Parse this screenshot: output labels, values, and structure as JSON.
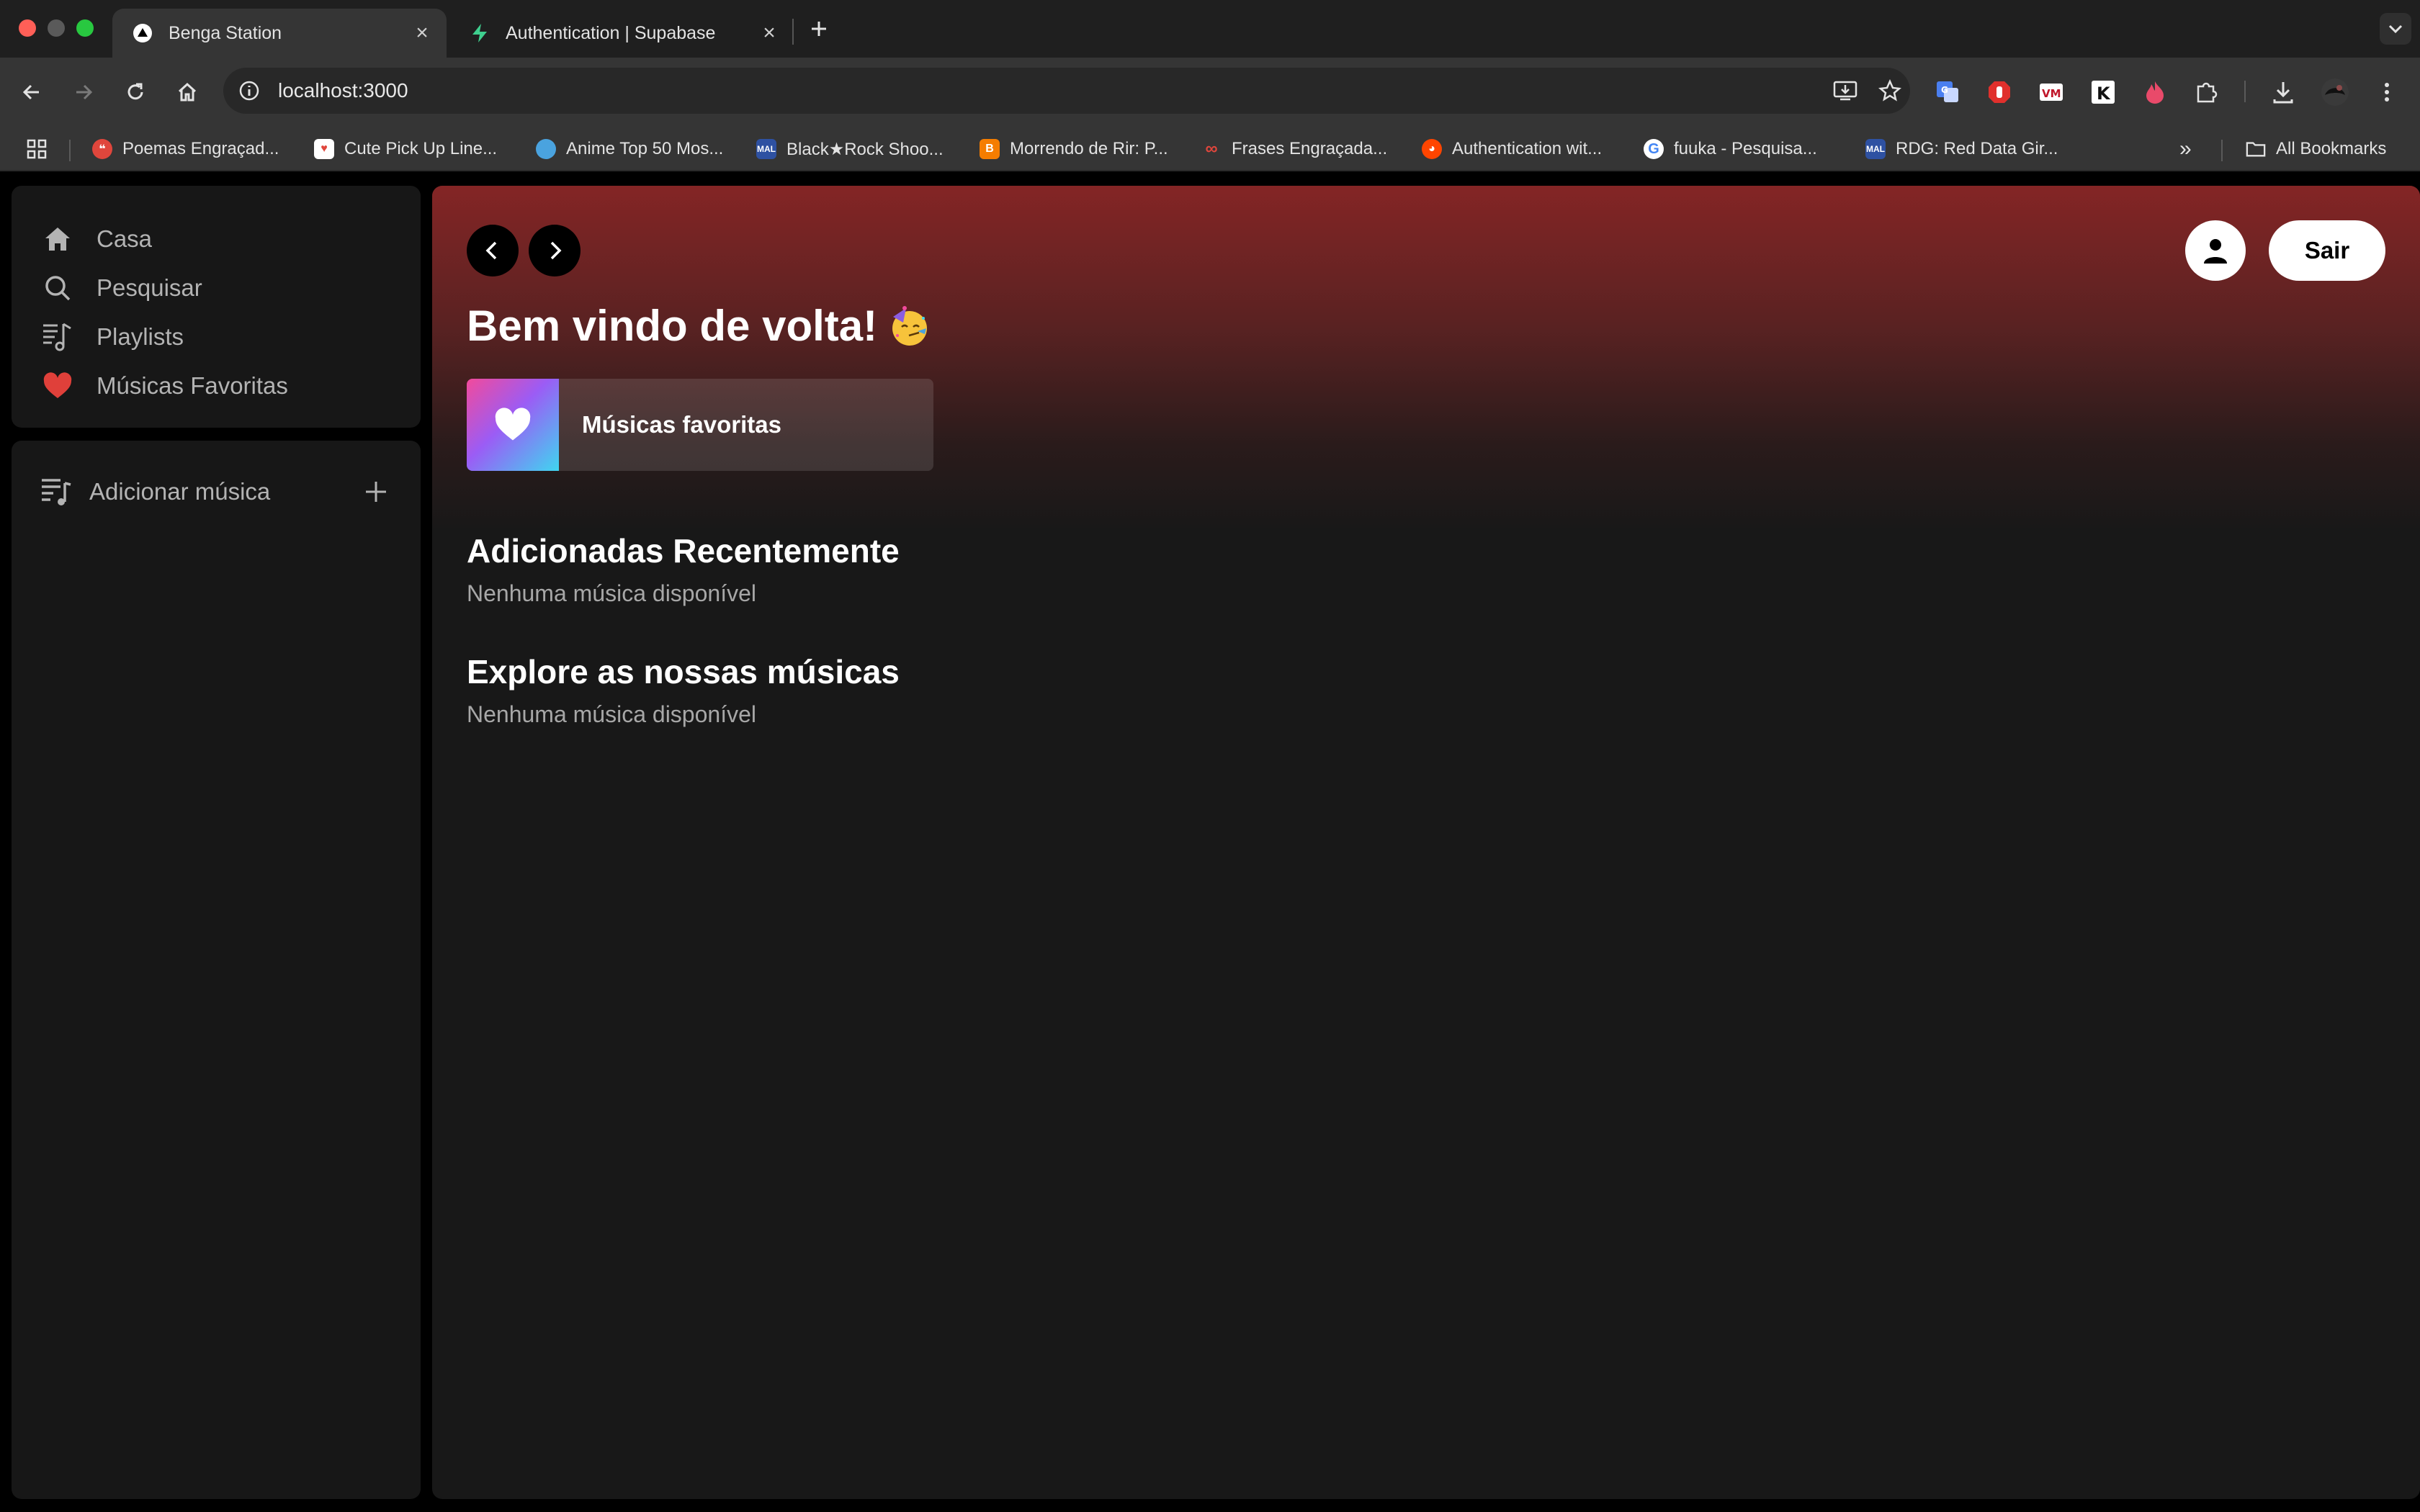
{
  "browser": {
    "tabs": [
      {
        "title": "Benga Station",
        "active": true
      },
      {
        "title": "Authentication | Supabase",
        "active": false
      }
    ],
    "url": "localhost:3000",
    "bookmarks": [
      {
        "label": "Poemas Engraçad...",
        "icon": "quote-icon",
        "color": "#e0463c"
      },
      {
        "label": "Cute Pick Up Line...",
        "icon": "heart-chat-icon",
        "color": "#ffffff"
      },
      {
        "label": "Anime Top 50 Mos...",
        "icon": "anime-icon",
        "color": "#4aa3df"
      },
      {
        "label": "Black★Rock Shoo...",
        "icon": "mal-icon",
        "color": "#2e51a2"
      },
      {
        "label": "Morrendo de Rir: P...",
        "icon": "blogger-icon",
        "color": "#f57d00"
      },
      {
        "label": "Frases Engraçada...",
        "icon": "link-icon",
        "color": "#e0463c"
      },
      {
        "label": "Authentication wit...",
        "icon": "reddit-icon",
        "color": "#ff4500"
      },
      {
        "label": "fuuka - Pesquisa...",
        "icon": "google-icon",
        "color": "#4285f4"
      },
      {
        "label": "RDG: Red Data Gir...",
        "icon": "mal-icon",
        "color": "#2e51a2"
      }
    ],
    "all_bookmarks": "All Bookmarks"
  },
  "sidebar": {
    "items": [
      {
        "label": "Casa",
        "icon": "home-icon"
      },
      {
        "label": "Pesquisar",
        "icon": "search-icon"
      },
      {
        "label": "Playlists",
        "icon": "playlist-icon"
      },
      {
        "label": "Músicas Favoritas",
        "icon": "heart-icon"
      }
    ],
    "library": {
      "label": "Adicionar música",
      "icon": "music-list-icon"
    }
  },
  "main": {
    "welcome": "Bem vindo de volta!",
    "welcome_emoji": "partying-face",
    "favorites_card": "Músicas favoritas",
    "sections": [
      {
        "title": "Adicionadas Recentemente",
        "empty": "Nenhuma música disponível"
      },
      {
        "title": "Explore as nossas músicas",
        "empty": "Nenhuma música disponível"
      }
    ],
    "logout": "Sair"
  },
  "colors": {
    "accent_red": "#842525",
    "heart_red": "#e0403a",
    "panel": "#171717",
    "main_bg": "#181818"
  }
}
